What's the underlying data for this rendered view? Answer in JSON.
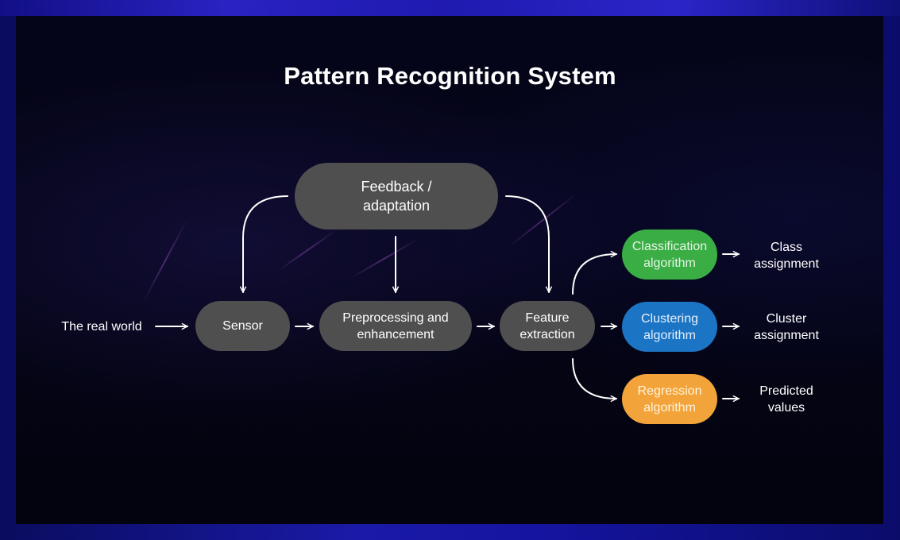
{
  "title": "Pattern Recognition System",
  "input_label": "The real world",
  "nodes": {
    "feedback": "Feedback /\nadaptation",
    "sensor": "Sensor",
    "preprocessing": "Preprocessing and\nenhancement",
    "feature_extraction": "Feature\nextraction",
    "classification": "Classification\nalgorithm",
    "clustering": "Clustering\nalgorithm",
    "regression": "Regression\nalgorithm"
  },
  "outputs": {
    "classification": "Class\nassignment",
    "clustering": "Cluster\nassignment",
    "regression": "Predicted\nvalues"
  },
  "colors": {
    "node_default": "#4f4f4f",
    "classification": "#3aad45",
    "clustering": "#1c74c4",
    "regression": "#f2a43b",
    "arrow": "#ffffff"
  }
}
